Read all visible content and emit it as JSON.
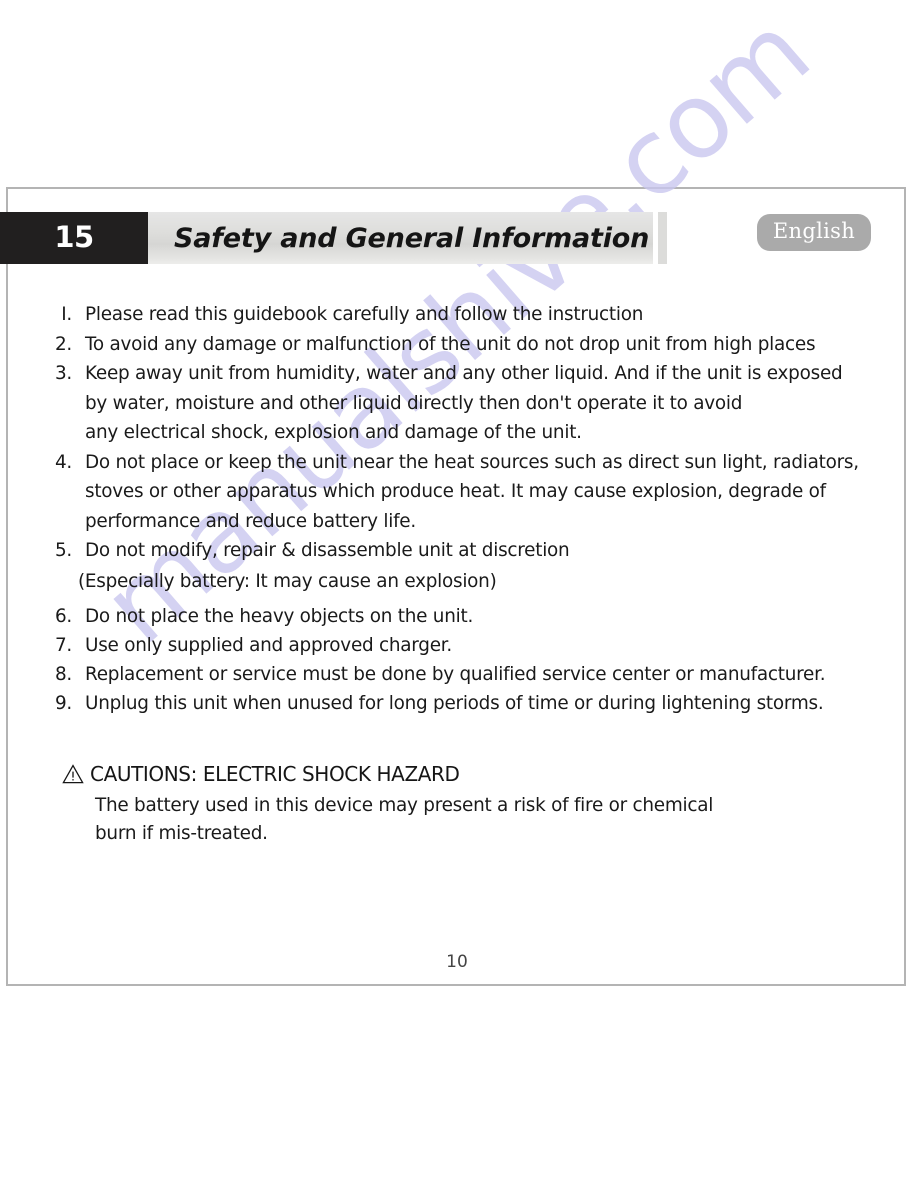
{
  "header": {
    "chapter_number": "15",
    "chapter_title": "Safety and General Information",
    "language_badge": "English"
  },
  "watermark": {
    "text": "manualshive.com",
    "color": "#c9c6ef"
  },
  "colors": {
    "chapter_number_block": "#211f1f",
    "chapter_title_block": "#dededc",
    "language_badge": "#aaaaaa",
    "page_border": "#b4b4b4",
    "body_text": "#1a1a1a"
  },
  "safety_list": {
    "group_a": [
      {
        "marker": "I.",
        "lines": [
          "Please read this guidebook carefully and follow the instruction"
        ]
      },
      {
        "marker": "2.",
        "lines": [
          "To avoid any damage or malfunction of the unit do not drop unit from high places"
        ]
      },
      {
        "marker": "3.",
        "lines": [
          "Keep away unit from humidity, water and any other liquid. And if the unit is exposed",
          "by water, moisture and other liquid directly then don't operate it to avoid",
          "any electrical shock, explosion and damage of the unit."
        ]
      },
      {
        "marker": "4.",
        "lines": [
          "Do not place or keep the unit near the heat sources such as direct sun light, radiators,",
          "stoves or other apparatus which produce heat. It may cause explosion, degrade of",
          "performance and reduce battery life."
        ]
      },
      {
        "marker": "5.",
        "lines": [
          "Do not modify, repair & disassemble unit at discretion"
        ]
      }
    ],
    "item5_subline": "(Especially battery: It may cause an explosion)",
    "group_b": [
      {
        "marker": "6.",
        "lines": [
          "Do not place the heavy objects on the unit."
        ]
      },
      {
        "marker": "7.",
        "lines": [
          "Use only supplied and approved charger."
        ]
      },
      {
        "marker": "8.",
        "lines": [
          "Replacement or service must be done by qualified service center or  manufacturer."
        ]
      },
      {
        "marker": "9.",
        "lines": [
          "Unplug this unit when unused for long periods of time or during lightening storms."
        ]
      }
    ]
  },
  "caution": {
    "icon": "warning-triangle-icon",
    "heading": "CAUTIONS: ELECTRIC SHOCK HAZARD",
    "line_1": "The battery used in this device may present a risk of fire or chemical",
    "line_2": "burn if mis-treated."
  },
  "footer": {
    "page_number": "10"
  }
}
